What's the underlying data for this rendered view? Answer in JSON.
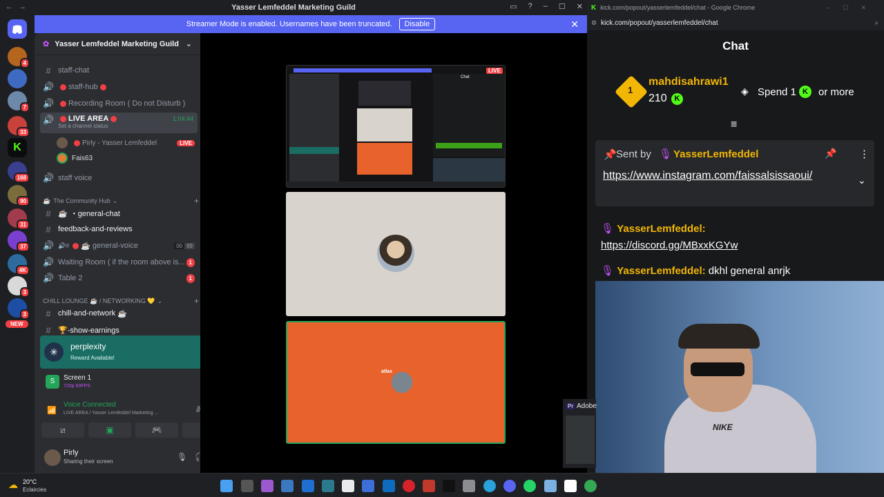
{
  "discord": {
    "window_title": "Yasser Lemfeddel Marketing Guild",
    "banner_text": "Streamer Mode is enabled. Usernames have been truncated.",
    "banner_button": "Disable",
    "guild_name": "Yasser Lemfeddel Marketing Guild",
    "rail_badges": [
      "4",
      "7",
      "33",
      "168",
      "90",
      "31",
      "37",
      "4K",
      "3",
      "3"
    ],
    "rail_new": "NEW",
    "channels_top": [
      {
        "icon": "#",
        "label": "staff-chat"
      },
      {
        "icon": "speaker",
        "label": "staff-hub"
      },
      {
        "icon": "speaker",
        "label": "Recording Room ( Do not Disturb )"
      }
    ],
    "live_area": {
      "label": "LIVE AREA",
      "timer": "1:04:44",
      "status": "Set a channel status"
    },
    "live_users": [
      {
        "name": "Pirly - Yasser Lemfeddel",
        "badge": "LIVE"
      },
      {
        "name": "Fais63"
      }
    ],
    "staff_voice": "staff voice",
    "category_community": "The Community Hub",
    "community_channels": [
      {
        "icon": "#",
        "label": "・general-chat",
        "badge": ""
      },
      {
        "icon": "#",
        "label": "feedback-and-reviews",
        "badge": ""
      },
      {
        "icon": "speaker",
        "label": "general-voice",
        "counts": [
          "00",
          "99"
        ],
        "badge": ""
      },
      {
        "icon": "speaker",
        "label": "Waiting Room ( if the room above is...",
        "badge": "1"
      },
      {
        "icon": "#",
        "label": "Table 2",
        "badge": "1"
      }
    ],
    "category_chill": "CHILL LOUNGE ☕ / NETWORKING 💛",
    "chill_channels": [
      {
        "label": "chill-and-network"
      },
      {
        "label": "🏆-show-earnings"
      }
    ],
    "perplexity": {
      "title": "perplexity",
      "subtitle": "Reward Available!"
    },
    "screen": {
      "title": "Screen 1",
      "subtitle": "720p 60FPS"
    },
    "voice": {
      "title": "Voice Connected",
      "subtitle": "LIVE AREA  / Yasser Lemfeddel Marketing ..."
    },
    "user": {
      "name": "Pirly",
      "status": "Sharing their screen"
    }
  },
  "kick": {
    "window_title": "kick.com/popout/yasserlemfeddel/chat - Google Chrome",
    "url": "kick.com/popout/yasserlemfeddel/chat",
    "chat_title": "Chat",
    "top_sub": {
      "rank": "1",
      "name": "mahdisahrawi1",
      "amount": "210",
      "spend": "Spend 1",
      "more": "or more"
    },
    "pinned": {
      "sent_by": "Sent by",
      "user": "YasserLemfeddel",
      "link": "https://www.instagram.com/faissalsissaoui/"
    },
    "messages": [
      {
        "user": "YasserLemfeddel",
        "text": "https://discord.gg/MBxxKGYw"
      },
      {
        "user": "YasserLemfeddel",
        "text": "dkhl general anrjk"
      }
    ],
    "adobe_label": "Adobe"
  },
  "taskbar": {
    "temp": "20°C",
    "weather": "Eclaircies"
  },
  "stage": {
    "tile1_live": "LIVE",
    "tile1_chat": "Chat",
    "tile3_text": "atlas"
  },
  "colors": {
    "blurple": "#5865f2",
    "kick_green": "#53fc18",
    "orange": "#e8622c",
    "live_red": "#f23f43"
  }
}
